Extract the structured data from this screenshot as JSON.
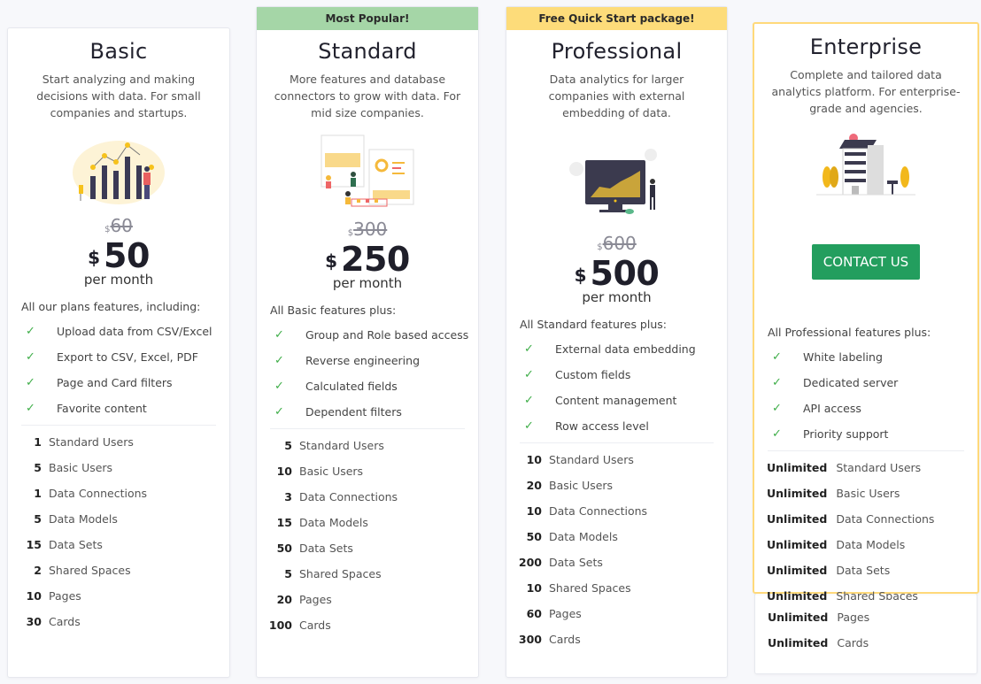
{
  "plans": [
    {
      "name": "Basic",
      "banner": null,
      "description": "Start analyzing and making decisions with data. For small companies and startups.",
      "illustration": "bar-chart-person-illustration",
      "old_price": {
        "currency": "$",
        "amount": "60"
      },
      "price": {
        "currency": "$",
        "amount": "50"
      },
      "period": "per month",
      "features_intro": "All our plans features, including:",
      "features": [
        "Upload data from CSV/Excel",
        "Export to CSV, Excel, PDF",
        "Page and Card filters",
        "Favorite content"
      ],
      "limits": [
        {
          "value": "1",
          "label": "Standard Users"
        },
        {
          "value": "5",
          "label": "Basic Users"
        },
        {
          "value": "1",
          "label": "Data Connections"
        },
        {
          "value": "5",
          "label": "Data Models"
        },
        {
          "value": "15",
          "label": "Data Sets"
        },
        {
          "value": "2",
          "label": "Shared Spaces"
        },
        {
          "value": "10",
          "label": "Pages"
        },
        {
          "value": "30",
          "label": "Cards"
        }
      ]
    },
    {
      "name": "Standard",
      "banner": "Most Popular!",
      "description": "More features and database connectors to grow with data. For mid size companies.",
      "illustration": "dashboard-team-illustration",
      "old_price": {
        "currency": "$",
        "amount": "300"
      },
      "price": {
        "currency": "$",
        "amount": "250"
      },
      "period": "per month",
      "features_intro": "All Basic features plus:",
      "features": [
        "Group and Role based access",
        "Reverse engineering",
        "Calculated fields",
        "Dependent filters"
      ],
      "limits": [
        {
          "value": "5",
          "label": "Standard Users"
        },
        {
          "value": "10",
          "label": "Basic Users"
        },
        {
          "value": "3",
          "label": "Data Connections"
        },
        {
          "value": "15",
          "label": "Data Models"
        },
        {
          "value": "50",
          "label": "Data Sets"
        },
        {
          "value": "5",
          "label": "Shared Spaces"
        },
        {
          "value": "20",
          "label": "Pages"
        },
        {
          "value": "100",
          "label": "Cards"
        }
      ]
    },
    {
      "name": "Professional",
      "banner": "Free Quick Start package!",
      "description": "Data analytics for larger companies with external embedding of data.",
      "illustration": "monitor-chart-illustration",
      "old_price": {
        "currency": "$",
        "amount": "600"
      },
      "price": {
        "currency": "$",
        "amount": "500"
      },
      "period": "per month",
      "features_intro": "All Standard features plus:",
      "features": [
        "External data embedding",
        "Custom fields",
        "Content management",
        "Row access level"
      ],
      "limits": [
        {
          "value": "10",
          "label": "Standard Users"
        },
        {
          "value": "20",
          "label": "Basic Users"
        },
        {
          "value": "10",
          "label": "Data Connections"
        },
        {
          "value": "50",
          "label": "Data Models"
        },
        {
          "value": "200",
          "label": "Data Sets"
        },
        {
          "value": "10",
          "label": "Shared Spaces"
        },
        {
          "value": "60",
          "label": "Pages"
        },
        {
          "value": "300",
          "label": "Cards"
        }
      ]
    },
    {
      "name": "Enterprise",
      "banner": null,
      "description": "Complete and tailored data analytics platform. For enterprise-grade and agencies.",
      "illustration": "building-illustration",
      "cta": "CONTACT US",
      "features_intro": "All Professional features plus:",
      "features": [
        "White labeling",
        "Dedicated server",
        "API access",
        "Priority support"
      ],
      "limits": [
        {
          "value": "Unlimited",
          "label": "Standard Users"
        },
        {
          "value": "Unlimited",
          "label": "Basic Users"
        },
        {
          "value": "Unlimited",
          "label": "Data Connections"
        },
        {
          "value": "Unlimited",
          "label": "Data Models"
        },
        {
          "value": "Unlimited",
          "label": "Data Sets"
        },
        {
          "value": "Unlimited",
          "label": "Shared Spaces"
        },
        {
          "value": "Unlimited",
          "label": "Pages"
        },
        {
          "value": "Unlimited",
          "label": "Cards"
        }
      ]
    }
  ],
  "colors": {
    "popular_banner": "#a5d6a7",
    "quickstart_banner": "#fddc7a",
    "enterprise_border": "#ffd97a",
    "cta": "#239e5e",
    "check": "#3fae49"
  },
  "icons": {
    "check": "✓"
  }
}
